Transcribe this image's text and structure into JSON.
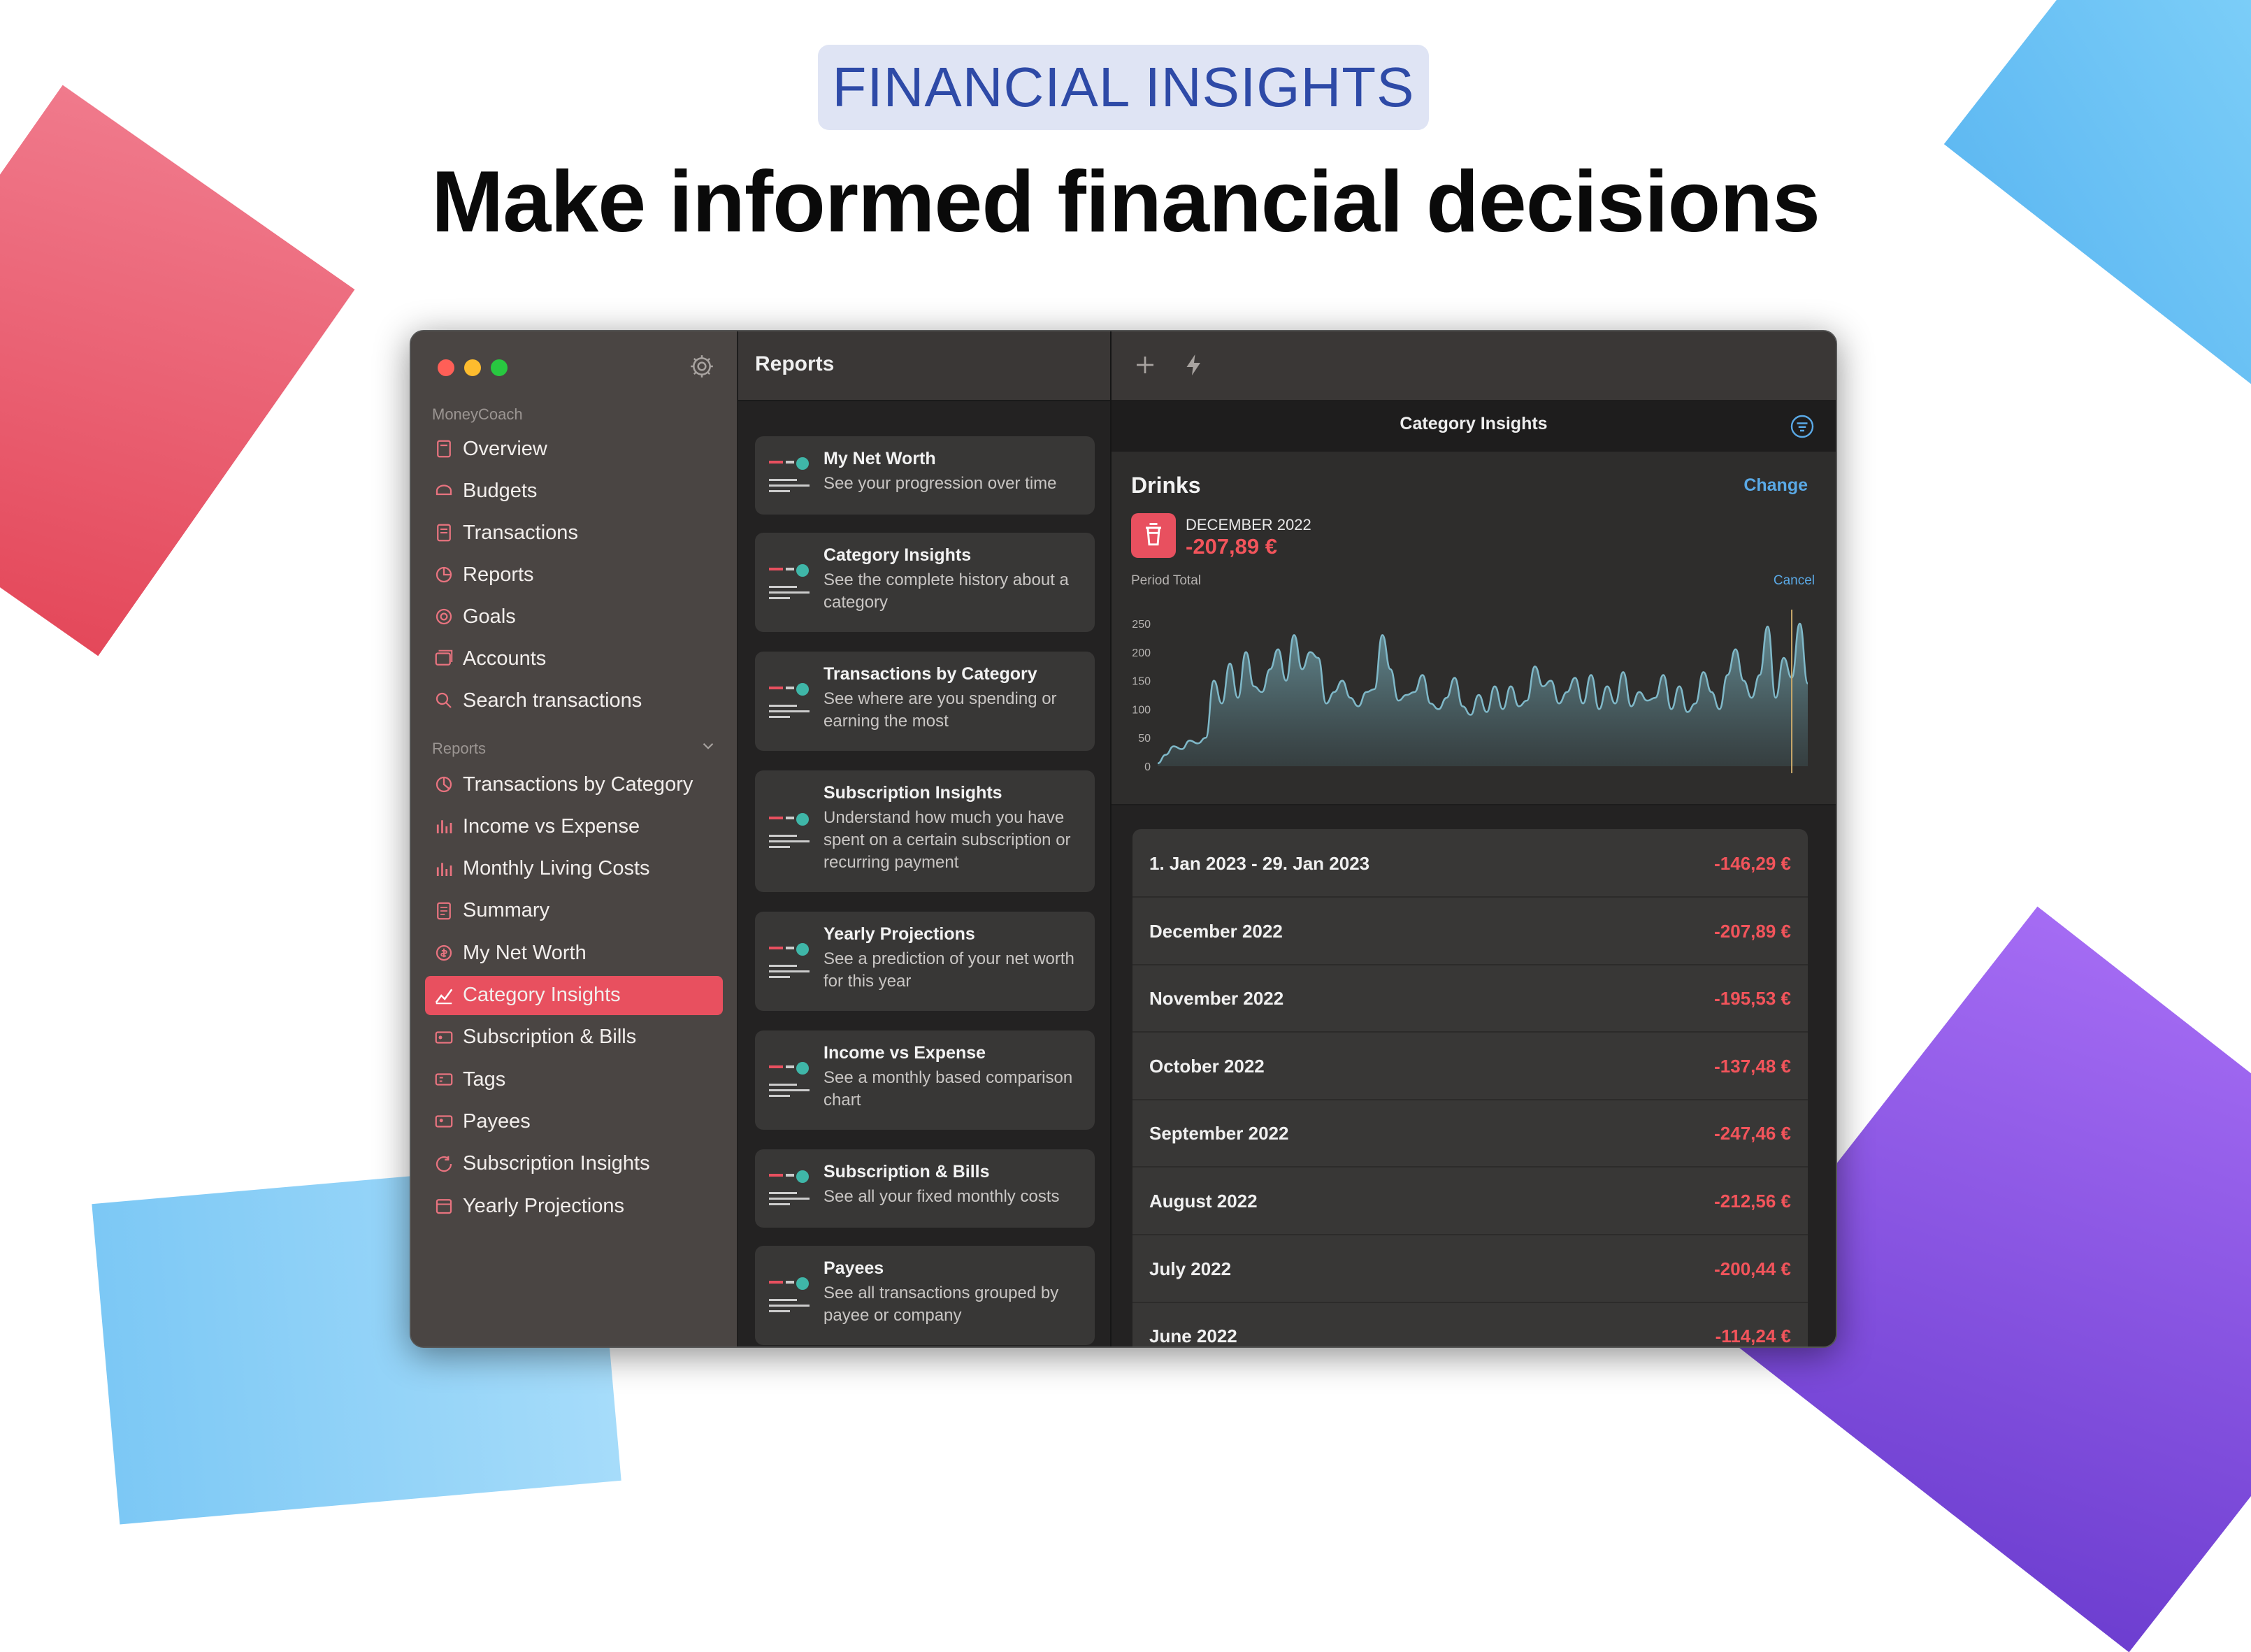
{
  "badge": "FINANCIAL INSIGHTS",
  "headline": "Make informed financial decisions",
  "sidebar": {
    "app_section": "MoneyCoach",
    "main_items": [
      {
        "label": "Overview",
        "icon": "overview-icon"
      },
      {
        "label": "Budgets",
        "icon": "budgets-icon"
      },
      {
        "label": "Transactions",
        "icon": "transactions-icon"
      },
      {
        "label": "Reports",
        "icon": "reports-icon"
      },
      {
        "label": "Goals",
        "icon": "goals-icon"
      },
      {
        "label": "Accounts",
        "icon": "accounts-icon"
      },
      {
        "label": "Search transactions",
        "icon": "search-icon"
      }
    ],
    "reports_section": "Reports",
    "report_items": [
      {
        "label": "Transactions by Category",
        "icon": "pie-icon"
      },
      {
        "label": "Income vs Expense",
        "icon": "bar-chart-icon"
      },
      {
        "label": "Monthly Living Costs",
        "icon": "bar-chart-icon"
      },
      {
        "label": "Summary",
        "icon": "document-icon"
      },
      {
        "label": "My Net Worth",
        "icon": "coin-icon"
      },
      {
        "label": "Category Insights",
        "icon": "line-chart-icon",
        "active": true
      },
      {
        "label": "Subscription & Bills",
        "icon": "bill-icon"
      },
      {
        "label": "Tags",
        "icon": "tag-icon"
      },
      {
        "label": "Payees",
        "icon": "payee-icon"
      },
      {
        "label": "Subscription Insights",
        "icon": "subscription-icon"
      },
      {
        "label": "Yearly Projections",
        "icon": "calendar-icon"
      }
    ]
  },
  "middle": {
    "title": "Reports",
    "cards": [
      {
        "title": "My Net Worth",
        "desc": "See your progression over time"
      },
      {
        "title": "Category Insights",
        "desc": "See the complete history about a category"
      },
      {
        "title": "Transactions by Category",
        "desc": "See where are you spending or earning the most"
      },
      {
        "title": "Subscription Insights",
        "desc": "Understand how much you have spent on a certain subscription or recurring payment"
      },
      {
        "title": "Yearly Projections",
        "desc": "See a prediction of your net worth for this year"
      },
      {
        "title": "Income vs Expense",
        "desc": "See a monthly based comparison chart"
      },
      {
        "title": "Subscription & Bills",
        "desc": "See all your fixed monthly costs"
      },
      {
        "title": "Payees",
        "desc": "See all transactions grouped by payee or company"
      }
    ]
  },
  "right": {
    "title": "Category Insights",
    "category": "Drinks",
    "change_label": "Change",
    "selected_period": "DECEMBER 2022",
    "selected_amount": "-207,89 €",
    "period_total_label": "Period Total",
    "cancel_label": "Cancel",
    "rows": [
      {
        "label": "1. Jan 2023 - 29. Jan 2023",
        "value": "-146,29 €"
      },
      {
        "label": "December 2022",
        "value": "-207,89 €"
      },
      {
        "label": "November 2022",
        "value": "-195,53 €"
      },
      {
        "label": "October 2022",
        "value": "-137,48 €"
      },
      {
        "label": "September 2022",
        "value": "-247,46 €"
      },
      {
        "label": "August 2022",
        "value": "-212,56 €"
      },
      {
        "label": "July 2022",
        "value": "-200,44 €"
      },
      {
        "label": "June 2022",
        "value": "-114,24 €"
      }
    ]
  },
  "colors": {
    "accent": "#e8505f",
    "negative": "#f2545b",
    "link": "#5aa9e6",
    "chart_line": "#7fb8c8"
  },
  "chart_data": {
    "type": "area",
    "yticks": [
      "250",
      "200",
      "150",
      "100",
      "50",
      "0"
    ],
    "ylim": [
      0,
      250
    ],
    "values": [
      5,
      20,
      35,
      30,
      45,
      40,
      50,
      150,
      110,
      180,
      120,
      200,
      140,
      130,
      170,
      205,
      150,
      230,
      170,
      200,
      190,
      110,
      130,
      150,
      120,
      105,
      130,
      135,
      230,
      170,
      115,
      125,
      130,
      160,
      110,
      100,
      120,
      155,
      105,
      90,
      125,
      95,
      140,
      100,
      140,
      105,
      115,
      175,
      140,
      150,
      110,
      130,
      155,
      110,
      160,
      100,
      140,
      110,
      165,
      105,
      130,
      115,
      120,
      160,
      100,
      140,
      95,
      110,
      165,
      130,
      100,
      160,
      205,
      150,
      120,
      160,
      245,
      120,
      190,
      155,
      250,
      145
    ]
  }
}
